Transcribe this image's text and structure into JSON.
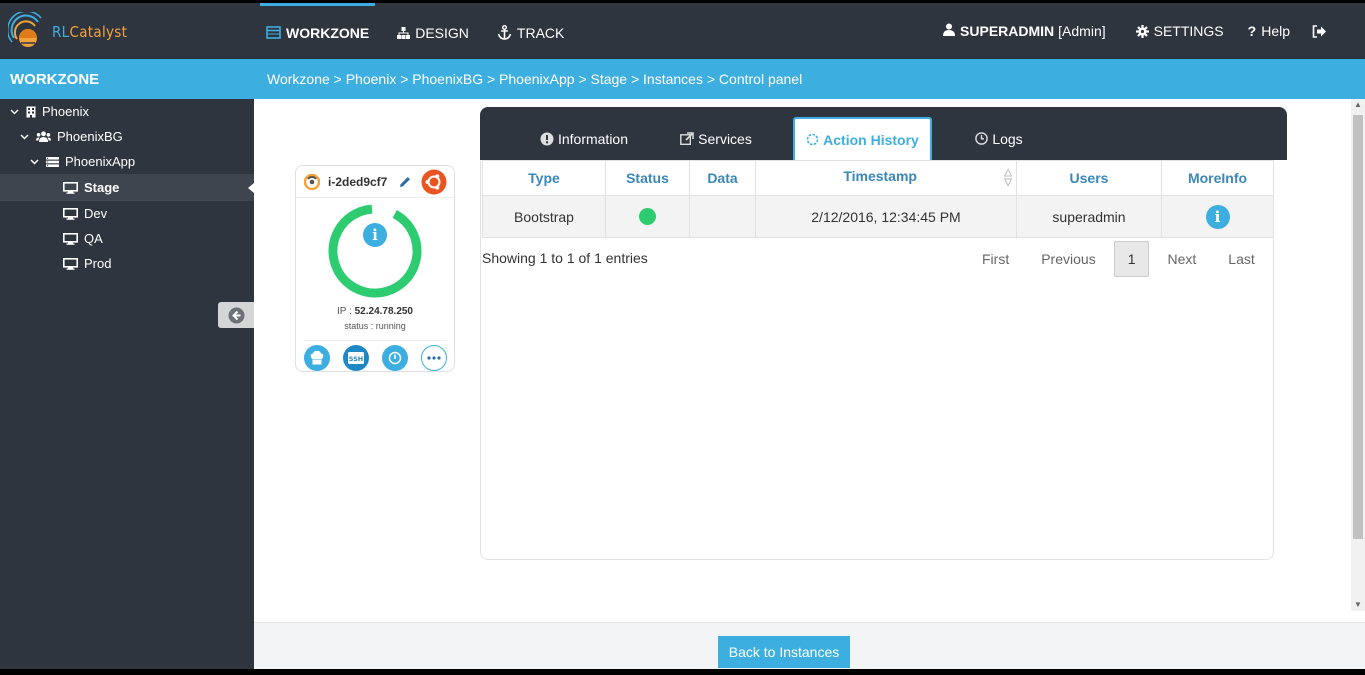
{
  "app": {
    "logo_prefix": "RL",
    "logo_suffix": "Catalyst"
  },
  "nav": {
    "items": [
      {
        "label": "WORKZONE",
        "icon": "workzone-icon",
        "active": true
      },
      {
        "label": "DESIGN",
        "icon": "sitemap-icon",
        "active": false
      },
      {
        "label": "TRACK",
        "icon": "anchor-icon",
        "active": false
      }
    ]
  },
  "user": {
    "name": "SUPERADMIN",
    "role": "[Admin]",
    "settings_label": "SETTINGS",
    "help_label": "Help"
  },
  "sidebar": {
    "title": "WORKZONE",
    "tree": [
      {
        "label": "Phoenix",
        "level": 0,
        "icon": "building-icon",
        "expanded": true
      },
      {
        "label": "PhoenixBG",
        "level": 1,
        "icon": "users-icon",
        "expanded": true
      },
      {
        "label": "PhoenixApp",
        "level": 2,
        "icon": "server-icon",
        "expanded": true
      },
      {
        "label": "Stage",
        "level": 3,
        "icon": "monitor-icon",
        "selected": true
      },
      {
        "label": "Dev",
        "level": 3,
        "icon": "monitor-icon"
      },
      {
        "label": "QA",
        "level": 3,
        "icon": "monitor-icon"
      },
      {
        "label": "Prod",
        "level": 3,
        "icon": "monitor-icon"
      }
    ]
  },
  "breadcrumb": "Workzone > Phoenix > PhoenixBG > PhoenixApp > Stage > Instances > Control panel",
  "instance": {
    "id": "i-2ded9cf7",
    "ip_label": "IP : ",
    "ip": "52.24.78.250",
    "status": "status : running",
    "os_icon": "ubuntu-icon",
    "status_color": "#2ecc71"
  },
  "tabs": [
    {
      "label": "Information",
      "icon": "exclamation-circle-icon",
      "active": false
    },
    {
      "label": "Services",
      "icon": "external-link-icon",
      "active": false
    },
    {
      "label": "Action History",
      "icon": "spinner-icon",
      "active": true
    },
    {
      "label": "Logs",
      "icon": "clock-icon",
      "active": false
    }
  ],
  "history": {
    "columns": [
      "Type",
      "Status",
      "Data",
      "Timestamp",
      "Users",
      "MoreInfo"
    ],
    "rows": [
      {
        "type": "Bootstrap",
        "status": "success",
        "data": "",
        "timestamp": "2/12/2016, 12:34:45 PM",
        "user": "superadmin",
        "moreinfo": "i"
      }
    ],
    "entries_text": "Showing 1 to 1 of 1 entries",
    "pager": {
      "first": "First",
      "previous": "Previous",
      "current": "1",
      "next": "Next",
      "last": "Last"
    }
  },
  "footer": {
    "back_label": "Back to Instances"
  },
  "colors": {
    "accent": "#3daee0",
    "dark": "#2f353e",
    "success": "#2ecc71",
    "ubuntu": "#e95420"
  }
}
